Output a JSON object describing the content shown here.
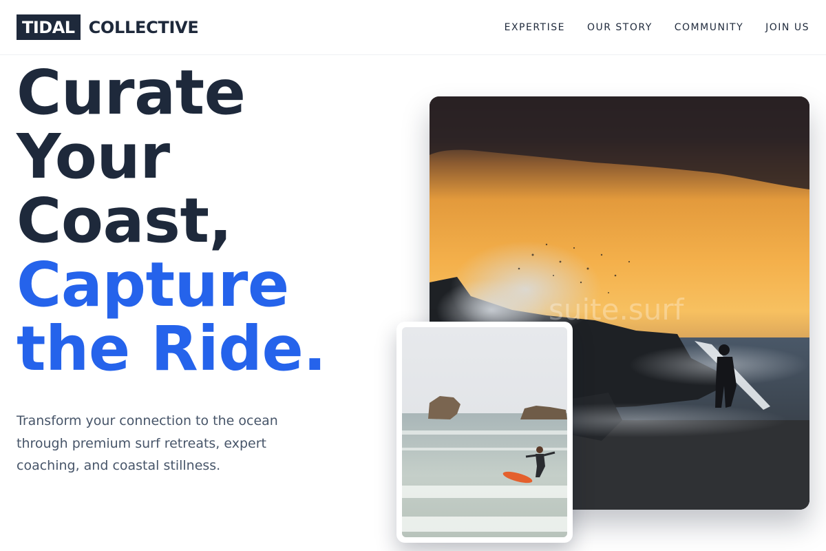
{
  "brand": {
    "mark": "TIDAL",
    "name": "COLLECTIVE"
  },
  "nav": {
    "items": [
      "EXPERTISE",
      "OUR STORY",
      "COMMUNITY",
      "JOIN US"
    ]
  },
  "hero": {
    "headline_dark": [
      "Curate",
      "Your",
      "Coast,"
    ],
    "headline_blue": [
      "Capture",
      "the Ride."
    ],
    "subtext": "Transform your connection to the ocean through premium surf retreats, expert coaching, and coastal stillness."
  },
  "watermark": "suite.surf",
  "colors": {
    "navy": "#1e293b",
    "accent_blue": "#2563eb",
    "body_text": "#475569",
    "sunset_orange": "#f2a640"
  }
}
